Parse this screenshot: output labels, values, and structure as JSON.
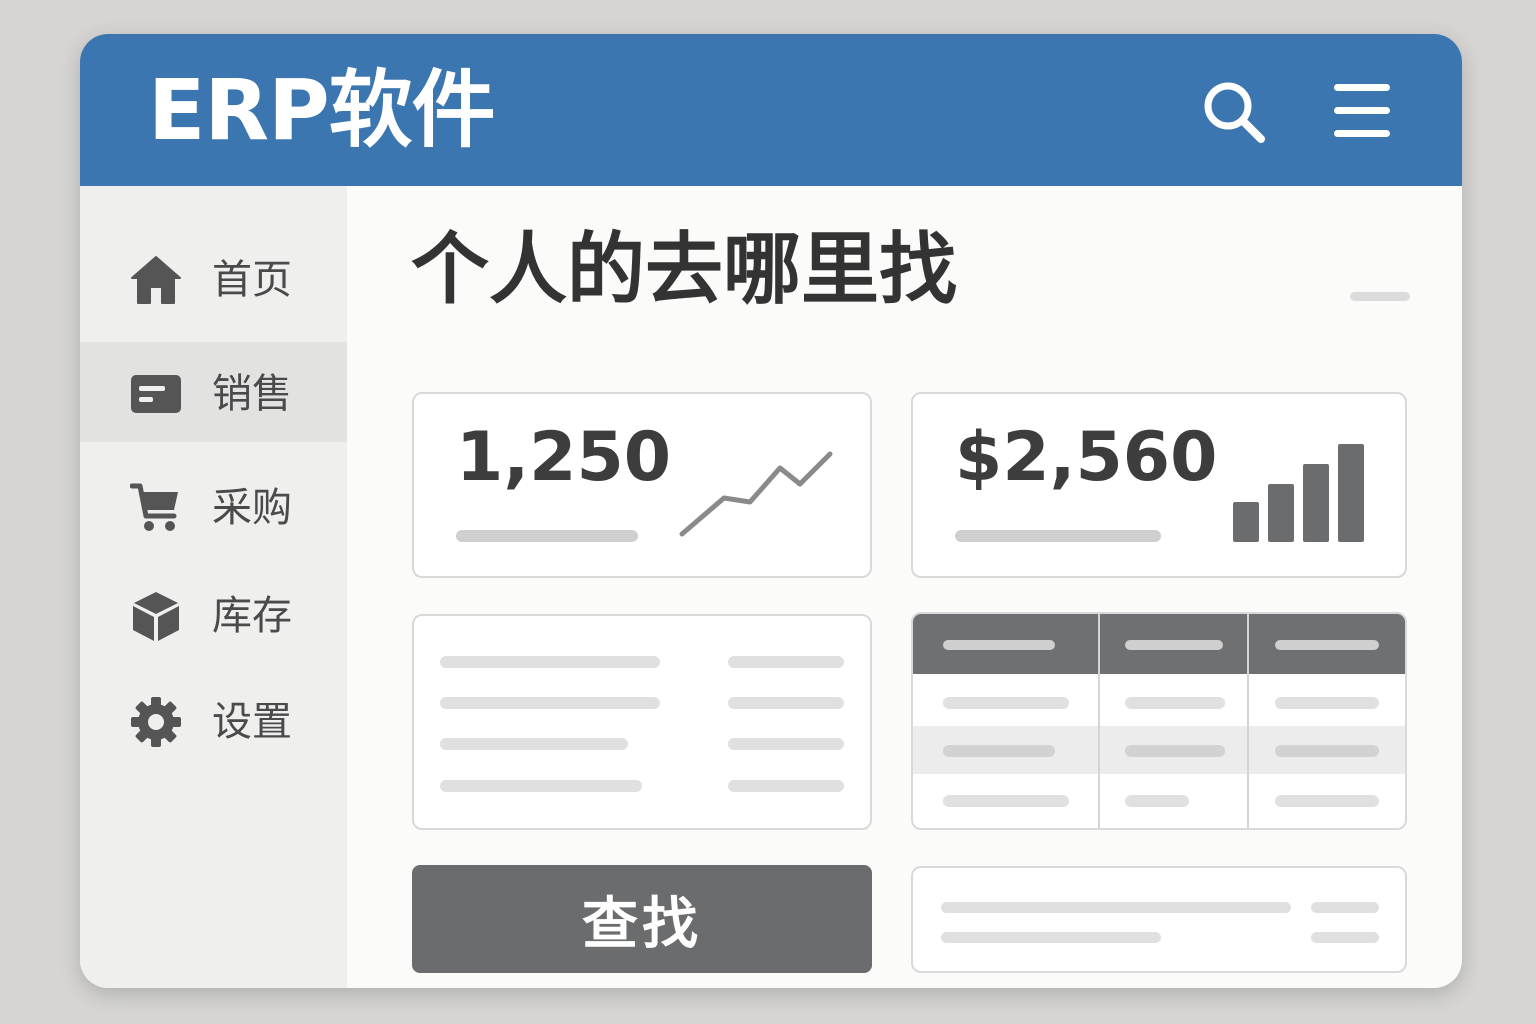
{
  "header": {
    "title": "ERP软件",
    "icons": {
      "search": "search-icon",
      "menu": "hamburger-menu-icon"
    }
  },
  "colors": {
    "header_bg": "#3b76b0",
    "sidebar_bg": "#efefee",
    "active_item_bg": "#e2e2e1",
    "button_bg": "#6b6c6e",
    "table_header_bg": "#6f7072"
  },
  "sidebar": {
    "items": [
      {
        "label": "首页",
        "icon": "home-icon",
        "active": false
      },
      {
        "label": "销售",
        "icon": "sales-card-icon",
        "active": true
      },
      {
        "label": "采购",
        "icon": "shopping-cart-icon",
        "active": false
      },
      {
        "label": "库存",
        "icon": "box-icon",
        "active": false
      },
      {
        "label": "设置",
        "icon": "gear-icon",
        "active": false
      }
    ]
  },
  "main": {
    "title": "个人的去哪里找",
    "stats": [
      {
        "value": "1,250",
        "icon": "line-trend-icon"
      },
      {
        "value": "$2,560",
        "icon": "bar-chart-icon"
      }
    ],
    "search_button_label": "查找"
  }
}
